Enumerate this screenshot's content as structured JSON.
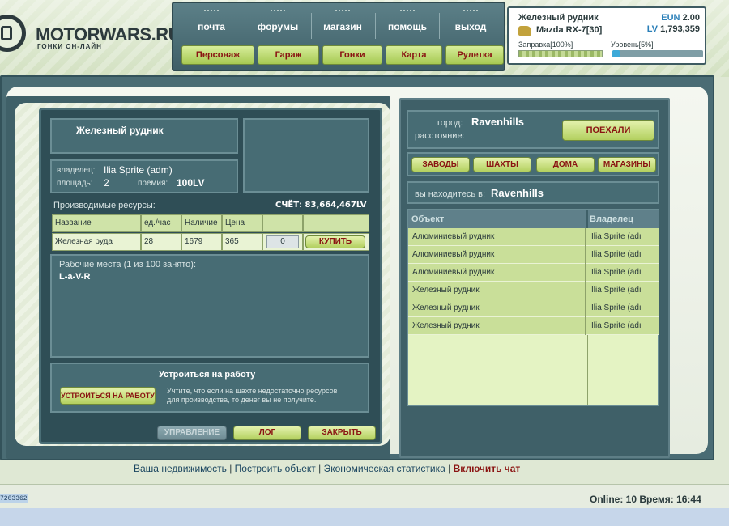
{
  "brand": {
    "name": "MOTORWARS.RU",
    "tagline": "ГОНКИ ОН-ЛАЙН"
  },
  "nav": {
    "top": [
      "почта",
      "форумы",
      "магазин",
      "помощь",
      "выход"
    ],
    "buttons": [
      "Персонаж",
      "Гараж",
      "Гонки",
      "Карта",
      "Рулетка"
    ]
  },
  "user": {
    "location": "Железный рудник",
    "car": "Mazda RX-7[30]",
    "eun_label": "EUN",
    "eun_value": "2.00",
    "lv_label": "LV",
    "lv_value": "1,793,359",
    "fuel_label": "Заправка[100%]",
    "fuel_percent": 100,
    "level_label": "Уровень[5%]",
    "level_percent": 5
  },
  "object": {
    "title": "Железный рудник",
    "owner_label": "владелец:",
    "owner": "Ilia Sprite (adm)",
    "area_label": "площадь:",
    "area": "2",
    "bonus_label": "премия:",
    "bonus": "100LV",
    "resources_label": "Производимые ресурсы:",
    "account": "СЧЁТ: 83,664,467LV"
  },
  "resource_table": {
    "headers": [
      "Название",
      "ед./час",
      "Наличие",
      "Цена",
      "",
      ""
    ],
    "rows": [
      {
        "name": "Железная руда",
        "rate": "28",
        "stock": "1679",
        "price": "365",
        "qty": "0",
        "buy": "КУПИТЬ"
      }
    ]
  },
  "workplaces": {
    "label": "Рабочие места (1 из 100 занято):",
    "workers": "L-a-V-R"
  },
  "job": {
    "title": "Устроиться на работу",
    "button": "УСТРОИТЬСЯ НА РАБОТУ",
    "note_line1": "Учтите, что если на шахте недостаточно ресурсов",
    "note_line2": "для производства, то денег вы не получите."
  },
  "tabs": {
    "manage": "УПРАВЛЕНИЕ",
    "log": "ЛОГ",
    "close": "ЗАКРЫТЬ"
  },
  "travel": {
    "city_label": "город:",
    "city": "Ravenhills",
    "distance_label": "расстояние:",
    "go": "ПОЕХАЛИ"
  },
  "filters": [
    "ЗАВОДЫ",
    "ШАХТЫ",
    "ДОМА",
    "МАГАЗИНЫ"
  ],
  "here": {
    "label": "вы находитесь в:",
    "city": "Ravenhills"
  },
  "objects_table": {
    "headers": [
      "Объект",
      "Владелец"
    ],
    "rows": [
      {
        "object": "Алюминиевый рудник",
        "owner": "Ilia Sprite (adı"
      },
      {
        "object": "Алюминиевый рудник",
        "owner": "Ilia Sprite (adı"
      },
      {
        "object": "Алюминиевый рудник",
        "owner": "Ilia Sprite (adı"
      },
      {
        "object": "Железный рудник",
        "owner": "Ilia Sprite (adı"
      },
      {
        "object": "Железный рудник",
        "owner": "Ilia Sprite (adı"
      },
      {
        "object": "Железный рудник",
        "owner": "Ilia Sprite (adı"
      }
    ]
  },
  "footer_links": [
    "Ваша недвижимость",
    "Построить объект",
    "Экономическая статистика",
    "Включить чат"
  ],
  "status": {
    "id": "7203362",
    "online": "Online: 10  Время: 16:44"
  },
  "colors": {
    "panel": "#476c74",
    "accent_green": "#b3d05f",
    "button_text": "#8a1412",
    "row_green": "#c9df99",
    "row_light": "#e4f3c3"
  }
}
